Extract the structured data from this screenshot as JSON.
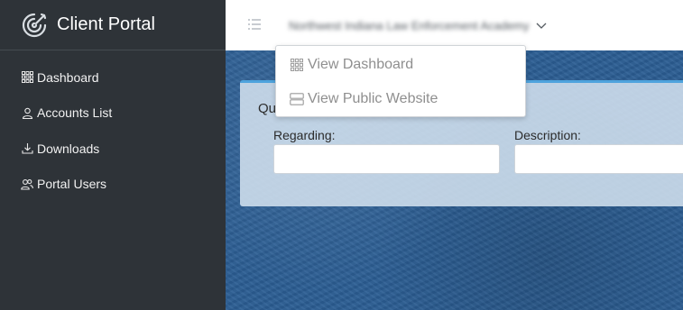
{
  "brand": {
    "title": "Client Portal",
    "logo_icon": "target-swirl-icon"
  },
  "sidebar": {
    "items": [
      {
        "label": "Dashboard",
        "icon": "grid-icon"
      },
      {
        "label": "Accounts List",
        "icon": "user-icon"
      },
      {
        "label": "Downloads",
        "icon": "download-icon"
      },
      {
        "label": "Portal Users",
        "icon": "users-icon"
      }
    ]
  },
  "header": {
    "org_name": "Northwest Indiana Law Enforcement Academy",
    "menu_icon": "list-icon",
    "chevron_icon": "chevron-down-icon"
  },
  "dropdown": {
    "items": [
      {
        "label": "View Dashboard",
        "icon": "grid-icon"
      },
      {
        "label": "View Public Website",
        "icon": "server-icon"
      }
    ]
  },
  "panel": {
    "title": "Qu",
    "regarding_label": "Regarding:",
    "regarding_value": "",
    "description_label": "Description:",
    "description_value": ""
  },
  "colors": {
    "sidebar_bg": "#2e3338",
    "accent_border": "#4ea3dd",
    "background_blue": "#2b5d93"
  }
}
